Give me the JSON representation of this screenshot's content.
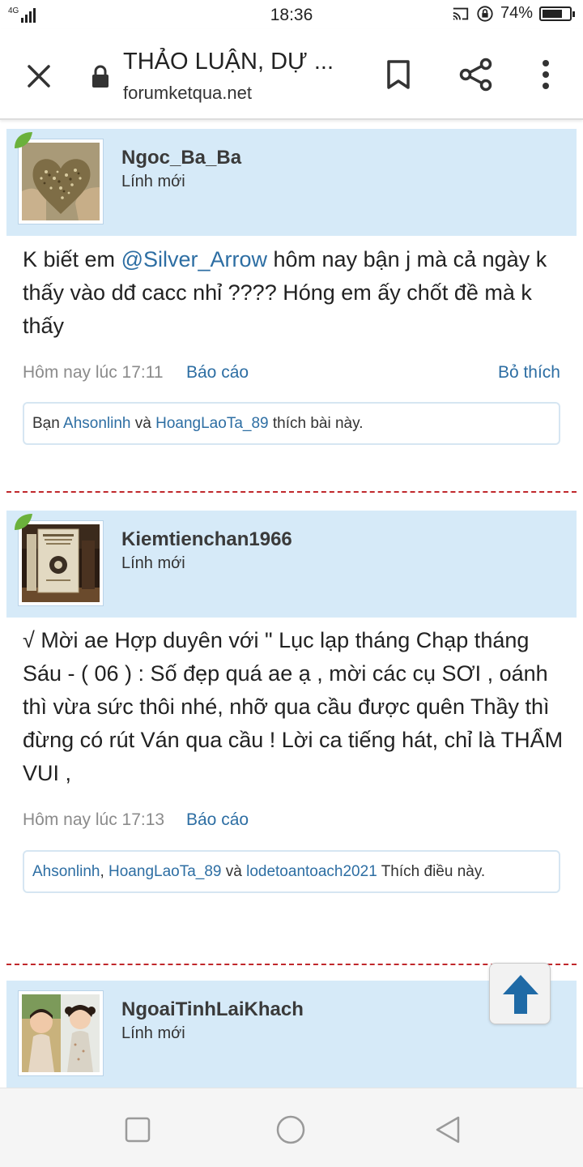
{
  "status_bar": {
    "network": "4G",
    "time": "18:36",
    "battery": "74%",
    "battery_level": 0.74
  },
  "toolbar": {
    "title": "THẢO LUẬN, DỰ ...",
    "url": "forumketqua.net"
  },
  "posts": [
    {
      "username": "Ngoc_Ba_Ba",
      "rank": "Lính mới",
      "message_before": "K biết em ",
      "mention": "@Silver_Arrow",
      "message_after": " hôm nay bận j mà cả ngày k thấy vào dđ cacc nhỉ ???? Hóng em ấy chốt đề mà k thấy",
      "time": "Hôm nay lúc 17:11",
      "report": "Báo cáo",
      "unlike": "Bỏ thích",
      "likes": {
        "prefix": "Bạn ",
        "user1": "Ahsonlinh",
        "and": " và ",
        "user2": "HoangLaoTa_89",
        "suffix": " thích bài này."
      }
    },
    {
      "username": "Kiemtienchan1966",
      "rank": "Lính mới",
      "message": "√ Mời ae Hợp duyên với \" Lục lạp tháng Chạp tháng Sáu - ( 06 ) : Số đẹp quá ae ạ , mời các cụ SƠI , oánh thì vừa sức thôi nhé, nhỡ qua cầu được quên Thầy thì đừng có rút Ván qua cầu ! Lời ca tiếng hát, chỉ là THẨM VUI ,",
      "time": "Hôm nay lúc 17:13",
      "report": "Báo cáo",
      "likes": {
        "user1": "Ahsonlinh",
        "sep": ", ",
        "user2": "HoangLaoTa_89",
        "and": " và ",
        "user3": "lodetoantoach2021",
        "suffix": " Thích điều này."
      }
    },
    {
      "username": "NgoaiTinhLaiKhach",
      "rank": "Lính mới"
    }
  ],
  "colors": {
    "link": "#2d6ea3",
    "user_box": "#d6eaf8",
    "divider": "#c0282c",
    "scroll_arrow": "#1f6aa6"
  }
}
